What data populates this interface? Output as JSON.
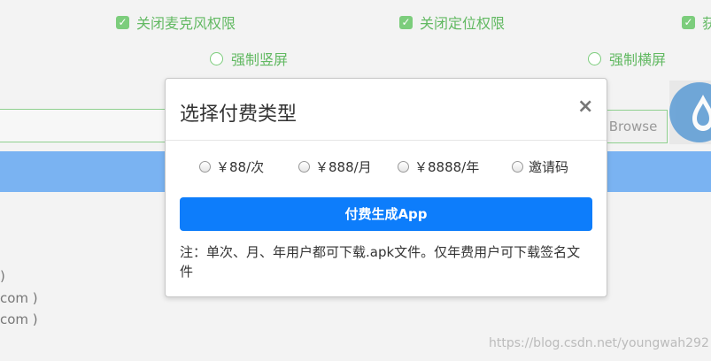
{
  "background": {
    "checkboxes": [
      {
        "label": "关闭麦克风权限",
        "checked": true
      },
      {
        "label": "关闭定位权限",
        "checked": true
      },
      {
        "label": "获",
        "checked": true
      }
    ],
    "radios": [
      {
        "label": "强制竖屏"
      },
      {
        "label": "强制横屏"
      }
    ],
    "browse_label": "Browse",
    "side_lines": [
      ")",
      "com )",
      "com )"
    ],
    "watermark": "https://blog.csdn.net/youngwah292"
  },
  "modal": {
    "title": "选择付费类型",
    "close_symbol": "×",
    "options": [
      {
        "label": "￥88/次"
      },
      {
        "label": "￥888/月"
      },
      {
        "label": "￥8888/年"
      },
      {
        "label": "邀请码"
      }
    ],
    "pay_button": "付费生成App",
    "note": "注：单次、月、年用户都可下载.apk文件。仅年费用户可下载签名文件"
  },
  "colors": {
    "accent_blue": "#0d7dfb",
    "green": "#7ccd7c",
    "band": "#7ab3f2"
  }
}
